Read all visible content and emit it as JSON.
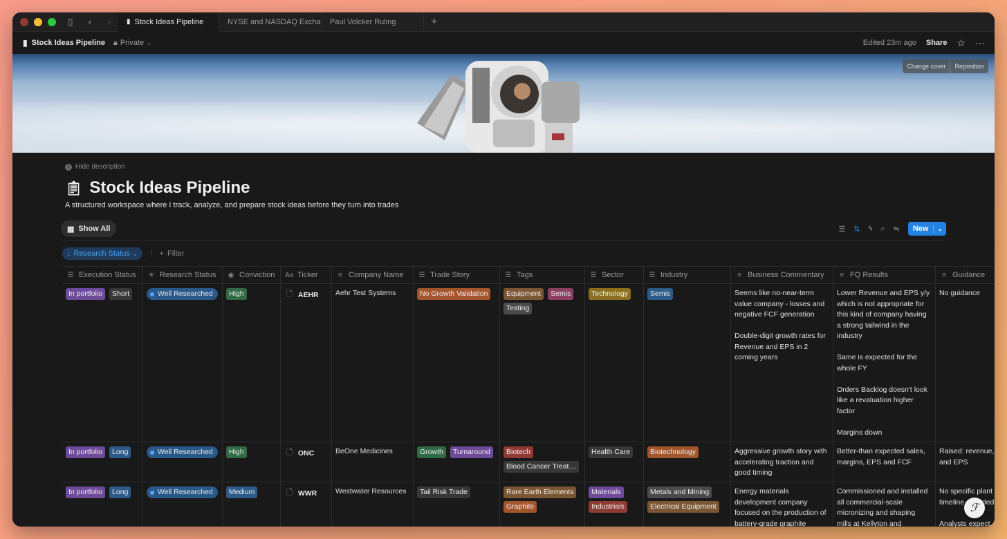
{
  "tabs": [
    {
      "label": "Stock Ideas Pipeline",
      "active": true
    },
    {
      "label": "NYSE and NASDAQ Exchan",
      "active": false
    },
    {
      "label": "Paul Volcker Ruling",
      "active": false
    }
  ],
  "topbar": {
    "page_name": "Stock Ideas Pipeline",
    "privacy": "Private",
    "edited": "Edited 23m ago",
    "share": "Share"
  },
  "cover": {
    "change_cover": "Change cover",
    "reposition": "Reposition"
  },
  "page": {
    "hide_description": "Hide description",
    "title": "Stock Ideas Pipeline",
    "description": "A structured workspace where I track, analyze, and prepare stock ideas before they turn into trades"
  },
  "view": {
    "show_all": "Show All",
    "new": "New"
  },
  "filters": {
    "research_status": "Research Status",
    "filter": "Filter"
  },
  "columns": {
    "execution_status": "Execution Status",
    "research_status": "Research Status",
    "conviction": "Conviction",
    "ticker": "Ticker",
    "company_name": "Company Name",
    "trade_story": "Trade Story",
    "tags": "Tags",
    "sector": "Sector",
    "industry": "Industry",
    "business_commentary": "Business Commentary",
    "fq_results": "FQ Results",
    "guidance": "Guidance"
  },
  "rows": [
    {
      "exec_a": "In portfolio",
      "exec_b": "Short",
      "research": "Well Researched",
      "conviction": "High",
      "ticker": "AEHR",
      "company": "Aehr Test Systems",
      "trade": [
        "No Growth Validation"
      ],
      "tags": [
        "Equipment",
        "Semis",
        "Testing"
      ],
      "sector": [
        "Technology"
      ],
      "industry": [
        "Semis"
      ],
      "business": "Seems like no-near-term value company - losses and negative FCF generation\n\nDouble-digit growth rates for Revenue and EPS in 2 coming years",
      "fq": "Lower Revenue and EPS y/y which is not appropriate for this kind of company having a strong tailwind in the industry\n\nSame is expected for the whole FY\n\nOrders Backlog doesn't look like a revaluation higher factor\n\nMargins down",
      "guidance": "No guidance"
    },
    {
      "exec_a": "In portfolio",
      "exec_b": "Long",
      "research": "Well Researched",
      "conviction": "High",
      "ticker": "ONC",
      "company": "BeOne Medicines",
      "trade": [
        "Growth",
        "Turnaround"
      ],
      "tags": [
        "Biotech",
        "Blood Cancer Treat…"
      ],
      "sector": [
        "Health Care"
      ],
      "industry": [
        "Biotechnology"
      ],
      "business": "Aggressive growth story with accelerating traction and good timing",
      "fq": "Better-than expected sales, margins, EPS and FCF",
      "guidance": "Raised: revenue, and EPS"
    },
    {
      "exec_a": "In portfolio",
      "exec_b": "Long",
      "research": "Well Researched",
      "conviction": "Medium",
      "ticker": "WWR",
      "company": "Westwater Resources",
      "trade": [
        "Tail Risk Trade"
      ],
      "tags": [
        "Rare Earth Elements",
        "Graphite"
      ],
      "sector": [
        "Materials",
        "Industrials"
      ],
      "industry": [
        "Metals and Mining",
        "Electrical Equipment"
      ],
      "business": "Energy materials development company focused on the production of battery-grade graphite",
      "fq": "Commissioned and installed all commercial-scale micronizing and shaping mills at Kellyton and",
      "guidance": "No specific plant timeline provided\n\nAnalysts expect"
    }
  ],
  "colors": {
    "accent": "#2383e2",
    "background": "#191919"
  }
}
